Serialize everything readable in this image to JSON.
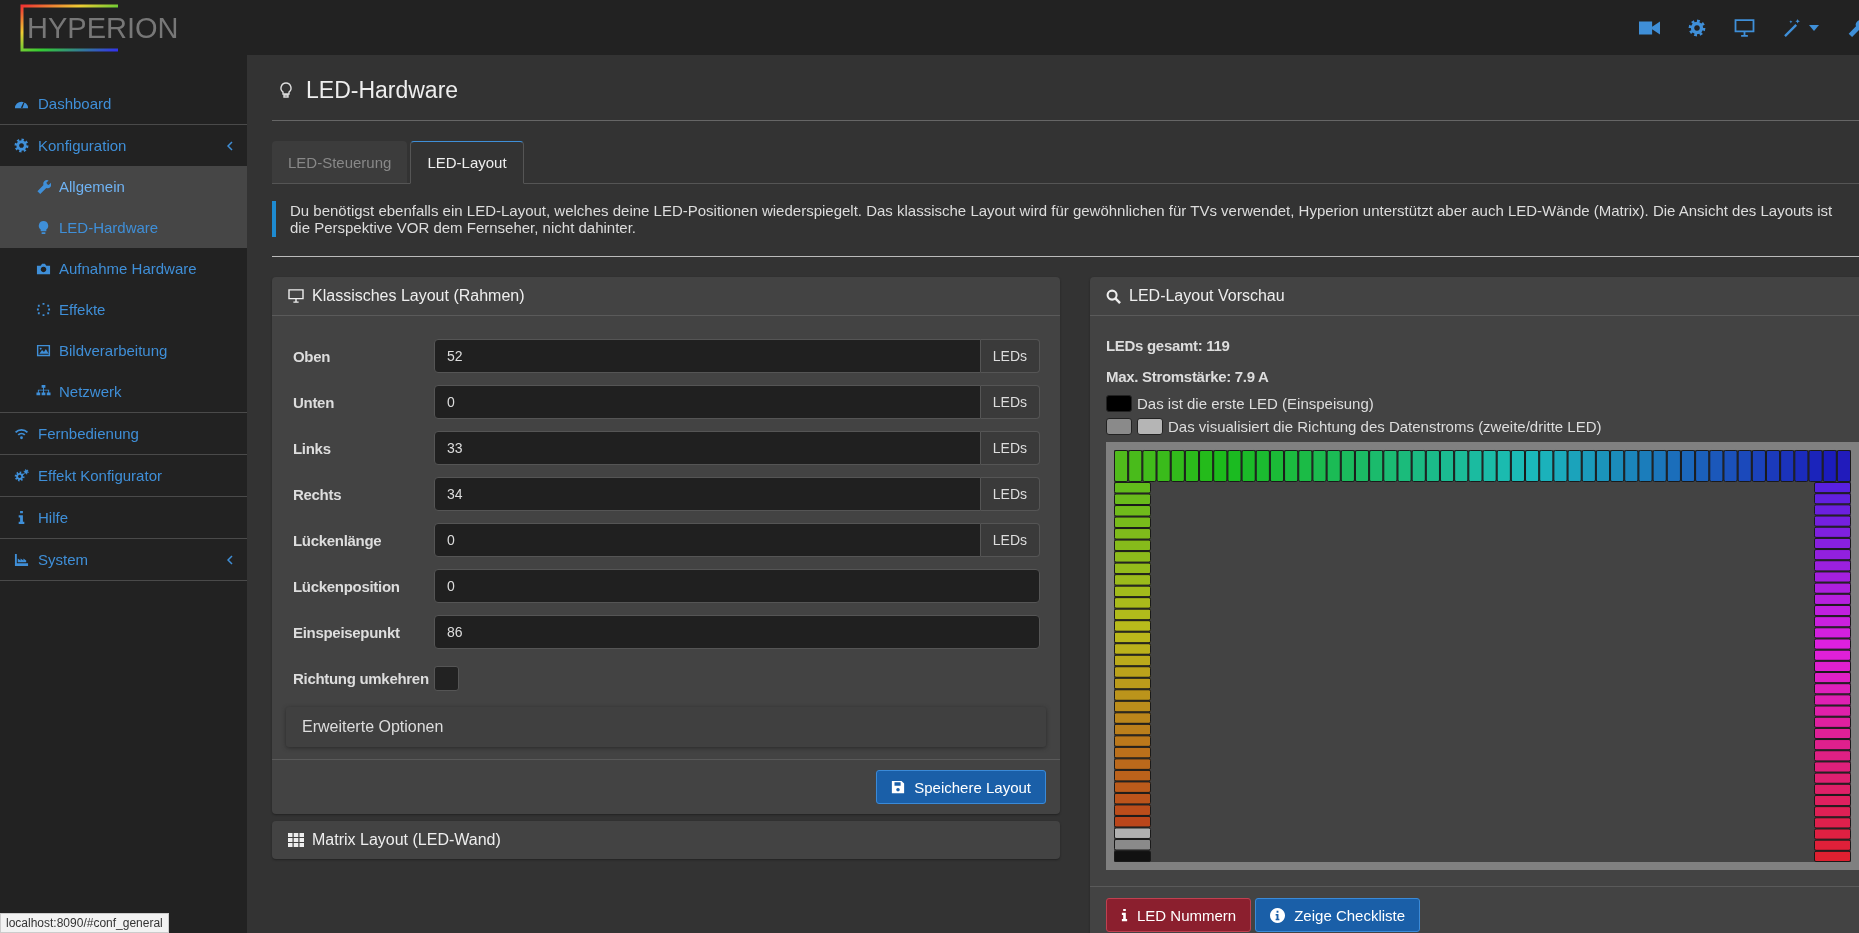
{
  "logo": {
    "text": "HYPERION"
  },
  "sidebar": {
    "items": [
      {
        "kind": "link",
        "label": "Dashboard"
      },
      {
        "kind": "tree",
        "label": "Konfiguration",
        "children": [
          {
            "label": "Allgemein",
            "active": true,
            "selected": true
          },
          {
            "label": "LED-Hardware",
            "active": true,
            "selected": false
          },
          {
            "label": "Aufnahme Hardware",
            "active": false,
            "selected": false
          },
          {
            "label": "Effekte",
            "active": false,
            "selected": false
          },
          {
            "label": "Bildverarbeitung",
            "active": false,
            "selected": false
          },
          {
            "label": "Netzwerk",
            "active": false,
            "selected": false
          }
        ]
      },
      {
        "kind": "link",
        "label": "Fernbedienung"
      },
      {
        "kind": "link",
        "label": "Effekt Konfigurator"
      },
      {
        "kind": "link",
        "label": "Hilfe"
      },
      {
        "kind": "tree",
        "label": "System"
      }
    ]
  },
  "page": {
    "title": "LED-Hardware",
    "tabs": [
      {
        "label": "LED-Steuerung",
        "selected": false
      },
      {
        "label": "LED-Layout",
        "selected": true
      }
    ],
    "alert": "Du benötigst ebenfalls ein LED-Layout, welches deine LED-Positionen wiederspiegelt. Das klassische Layout wird für gewöhnlichen für TVs verwendet, Hyperion unterstützt aber auch LED-Wände (Matrix). Die Ansicht des Layouts ist die Perspektive VOR dem Fernseher, nicht dahinter."
  },
  "classic_panel": {
    "title": "Klassisches Layout (Rahmen)",
    "fields": [
      {
        "kind": "number",
        "label": "Oben",
        "value": "52",
        "addon": "LEDs"
      },
      {
        "kind": "number",
        "label": "Unten",
        "value": "0",
        "addon": "LEDs"
      },
      {
        "kind": "number",
        "label": "Links",
        "value": "33",
        "addon": "LEDs"
      },
      {
        "kind": "number",
        "label": "Rechts",
        "value": "34",
        "addon": "LEDs"
      },
      {
        "kind": "number",
        "label": "Lückenlänge",
        "value": "0",
        "addon": "LEDs"
      },
      {
        "kind": "number",
        "label": "Lückenposition",
        "value": "0"
      },
      {
        "kind": "number",
        "label": "Einspeisepunkt",
        "value": "86"
      },
      {
        "kind": "checkbox",
        "label": "Richtung umkehren",
        "checked": false
      }
    ],
    "advanced": "Erweiterte Optionen",
    "save_button": "Speichere Layout"
  },
  "matrix_panel": {
    "title": "Matrix Layout (LED-Wand)"
  },
  "preview_panel": {
    "title": "LED-Layout Vorschau",
    "stats": [
      "LEDs gesamt: 119",
      "Max. Stromstärke: 7.9 A"
    ],
    "legend": [
      "Das ist die erste LED (Einspeisung)",
      "Das visualisiert die Richtung des Datenstroms (zweite/dritte LED)"
    ],
    "buttons": [
      {
        "kind": "danger",
        "label": "LED Nummern"
      },
      {
        "kind": "primary",
        "label": "Zeige Checkliste"
      }
    ]
  },
  "status_bar": {
    "url": "localhost:8090/#conf_general"
  }
}
